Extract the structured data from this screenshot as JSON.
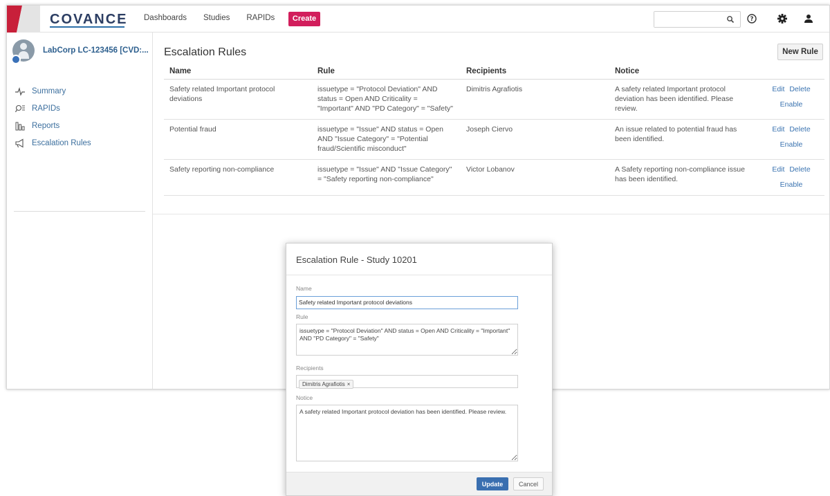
{
  "brand": {
    "name": "COVANCE",
    "accent_red": "#c8203a",
    "navy": "#2c3e63"
  },
  "nav": {
    "items": [
      "Dashboards",
      "Studies",
      "RAPIDs"
    ],
    "create_label": "Create",
    "create_color": "#d21e5c"
  },
  "topbar": {
    "search_placeholder": "",
    "icons": [
      "search-icon",
      "help-icon",
      "gear-icon",
      "user-icon"
    ]
  },
  "sidebar": {
    "study_title": "LabCorp LC-123456 [CVD:...",
    "items": [
      {
        "label": "Summary",
        "icon": "pulse-icon"
      },
      {
        "label": "RAPIDs",
        "icon": "rapids-icon"
      },
      {
        "label": "Reports",
        "icon": "bar-chart-icon"
      },
      {
        "label": "Escalation Rules",
        "icon": "megaphone-icon"
      }
    ]
  },
  "main": {
    "title": "Escalation Rules",
    "new_rule_label": "New Rule",
    "columns": [
      "Name",
      "Rule",
      "Recipients",
      "Notice"
    ],
    "rows": [
      {
        "name": "Safety related Important protocol deviations",
        "rule": "issuetype = \"Protocol Deviation\" AND status = Open AND Criticality = \"Important\" AND \"PD Category\" = \"Safety\"",
        "recipients": "Dimitris Agrafiotis",
        "notice": "A safety related Important protocol deviation has been identified. Please review."
      },
      {
        "name": "Potential fraud",
        "rule": "issuetype = \"Issue\" AND status = Open AND \"Issue Category\" = \"Potential fraud/Scientific misconduct\"",
        "recipients": "Joseph Ciervo",
        "notice": "An issue related to potential fraud has been identified."
      },
      {
        "name": "Safety reporting non-compliance",
        "rule": "issuetype = \"Issue\" AND \"Issue Category\" = \"Safety reporting non-compliance\"",
        "recipients": "Victor Lobanov",
        "notice": "A Safety reporting non-compliance issue has been identified."
      }
    ],
    "actions": {
      "edit": "Edit",
      "delete": "Delete",
      "enable": "Enable"
    }
  },
  "modal": {
    "title": "Escalation Rule - Study 10201",
    "name_label": "Name",
    "name_value": "Safety related Important protocol deviations",
    "rule_label": "Rule",
    "rule_value": "issuetype = \"Protocol Deviation\" AND status = Open AND Criticality = \"Important\" AND \"PD Category\" = \"Safety\"",
    "recipients_label": "Recipients",
    "recipient_tag": "Dimitris Agrafiotis",
    "tag_remove": "×",
    "notice_label": "Notice",
    "notice_value": "A safety related Important protocol deviation has been identified. Please review.",
    "update_label": "Update",
    "cancel_label": "Cancel"
  }
}
